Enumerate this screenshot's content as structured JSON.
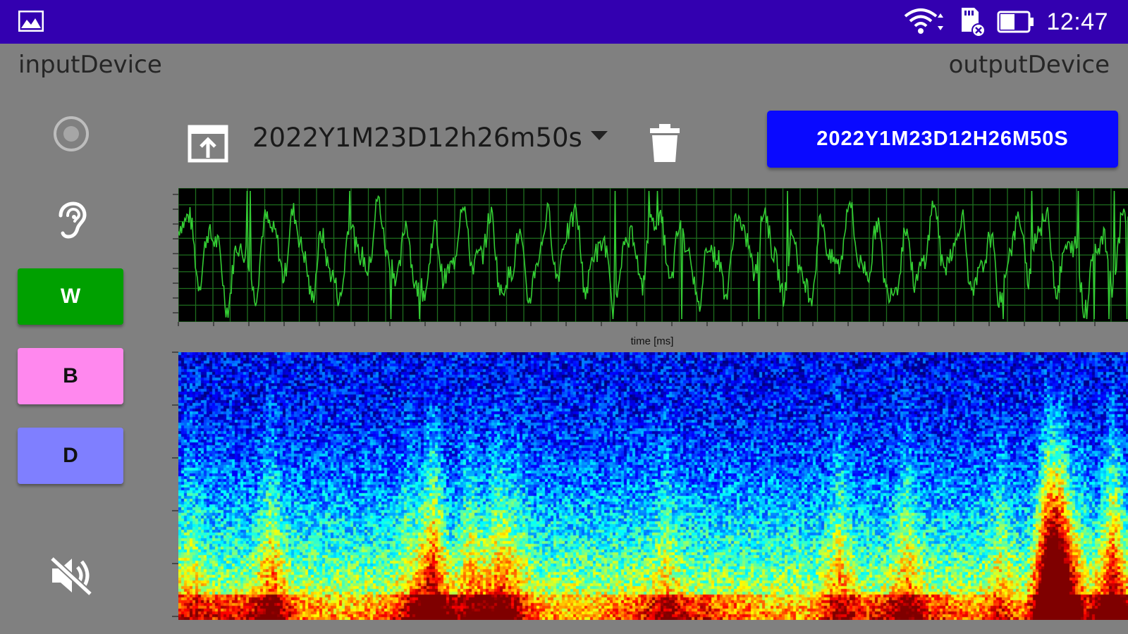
{
  "status_bar": {
    "notification_icon": "image-icon",
    "wifi_icon": "wifi-icon",
    "sd_icon": "sd-card-icon",
    "battery_icon": "battery-icon",
    "time": "12:47",
    "colors": {
      "background": "#3300b0"
    }
  },
  "devices": {
    "input_label": "inputDevice",
    "output_label": "outputDevice"
  },
  "sidebar": {
    "record_icon": "record-icon",
    "ear_icon": "hearing-icon",
    "mute_icon": "volume-off-icon",
    "buttons": [
      {
        "label": "W",
        "color": "#00a000"
      },
      {
        "label": "B",
        "color": "#ff88ee"
      },
      {
        "label": "D",
        "color": "#7f7fff"
      }
    ]
  },
  "toolbar": {
    "upload_icon": "upload-icon",
    "selected_file": "2022Y1M23D12h26m50s",
    "delete_icon": "trash-icon",
    "file_button_label": "2022Y1M23D12H26M50S",
    "file_button_color": "#0909ff"
  },
  "waveform": {
    "xlabel": "time [ms]",
    "line_color": "#33cc33",
    "grid_color": "#1e6e1e"
  },
  "spectrogram": {
    "colormap": "jet"
  }
}
